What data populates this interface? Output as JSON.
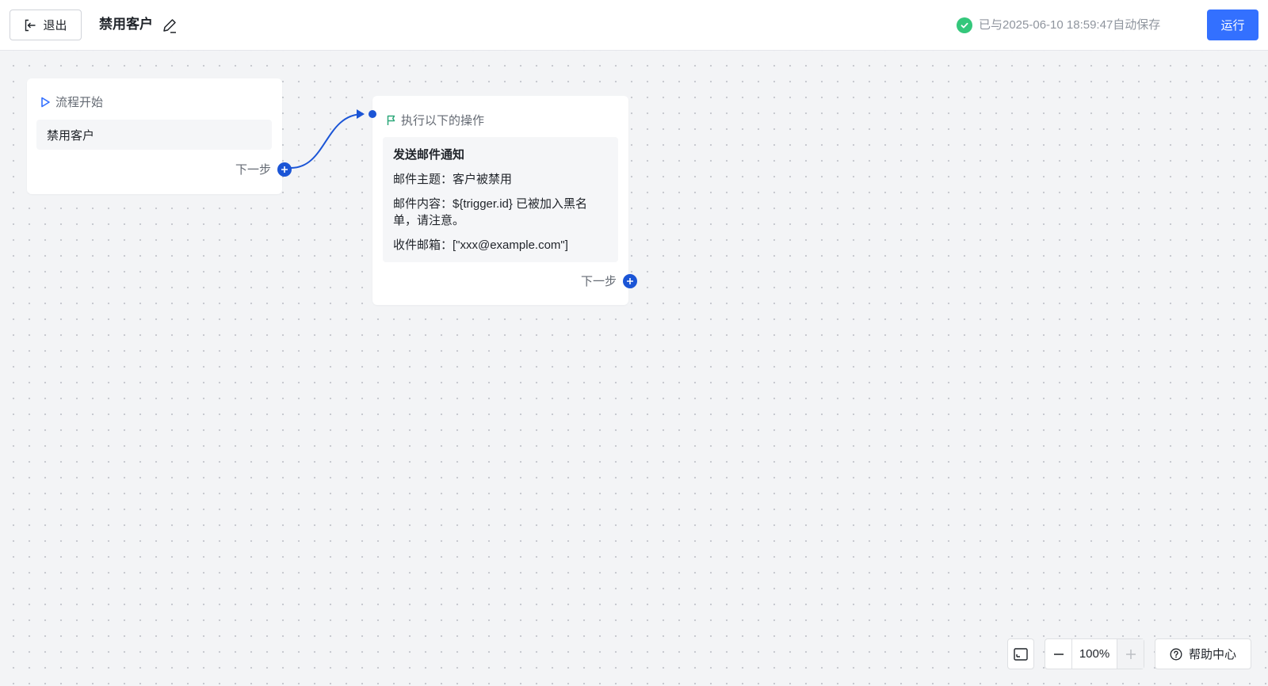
{
  "header": {
    "exit_label": "退出",
    "title": "禁用客户",
    "save_status": "已与2025-06-10 18:59:47自动保存",
    "run_label": "运行"
  },
  "canvas": {
    "start_node": {
      "header_label": "流程开始",
      "trigger_name": "禁用客户",
      "next_label": "下一步"
    },
    "action_node": {
      "header_label": "执行以下的操作",
      "title": "发送邮件通知",
      "subject_line": "邮件主题：客户被禁用",
      "content_line": "邮件内容：${trigger.id} 已被加入黑名单，请注意。",
      "recipient_line": "收件邮箱：[\"xxx@example.com\"]",
      "next_label": "下一步"
    }
  },
  "controls": {
    "zoom_level": "100%",
    "help_label": "帮助中心"
  },
  "colors": {
    "primary": "#3370ff",
    "connector": "#1b55d6",
    "success": "#34c77b",
    "flag": "#2ea87a",
    "canvas_bg": "#f3f4f6"
  },
  "icons": {
    "exit": "exit-icon",
    "edit": "edit-pencil-icon",
    "save_ok": "check-circle-icon",
    "start": "play-triangle-icon",
    "action": "flag-icon",
    "add": "plus-circle-icon",
    "fit": "fit-view-icon",
    "zoom_out": "minus-icon",
    "zoom_in": "plus-icon",
    "help": "question-circle-icon"
  }
}
